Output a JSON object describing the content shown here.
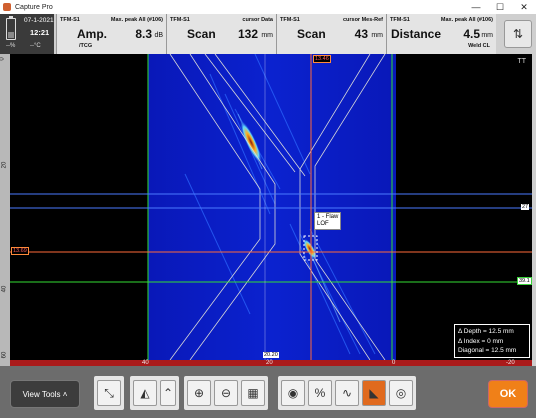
{
  "window": {
    "title": "Capture Pro",
    "minimize": "—",
    "maximize": "☐",
    "close": "✕"
  },
  "status": {
    "date": "07-1-2021",
    "time": "12:21",
    "battery": "--%",
    "temperature": "--°C"
  },
  "readouts": [
    {
      "source": "TFM-S1",
      "label": "Max. peak All (#106)",
      "main": "Amp.",
      "sub": "/TCG",
      "value": "8.3",
      "unit": "dB",
      "sub2": ""
    },
    {
      "source": "TFM-S1",
      "label": "cursor Data",
      "main": "Scan",
      "sub": "",
      "value": "132",
      "unit": "mm",
      "sub2": ""
    },
    {
      "source": "TFM-S1",
      "label": "cursor Mes-Ref",
      "main": "Scan",
      "sub": "",
      "value": "43",
      "unit": "mm",
      "sub2": ""
    },
    {
      "source": "TFM-S1",
      "label": "Max. peak All (#106)",
      "main": "Distance",
      "sub": "",
      "value": "4.5",
      "unit": "mm",
      "sub2": "Weld CL"
    }
  ],
  "settings_icon": "settings-swap-icon",
  "scan": {
    "mode_label": "TT",
    "left_ruler": [
      "0",
      "20",
      "40",
      "60"
    ],
    "bottom_ruler": [
      "40",
      "20",
      "0",
      "-20",
      "-40"
    ],
    "cursor_tags": {
      "top_red": "13.46",
      "left_red": "13.69",
      "right_blue": "27",
      "right_green": "39.1",
      "bottom_white": "20.20"
    },
    "flaw": {
      "line1": "1 - Flaw",
      "line2": "LOF"
    },
    "measurement": {
      "depth": "Δ Depth   = 12.5   mm",
      "index": "Δ Index    = 0 mm",
      "diagonal": "Diagonal = 12.5   mm"
    },
    "colors": {
      "background": "#000000",
      "scan_blue": "#0a1fc8",
      "cursor_red": "#ff6a3a",
      "cursor_green": "#33dd33",
      "cursor_blue": "#4a7aff",
      "ruler_red": "#aa1a1a"
    }
  },
  "toolbar": {
    "view_tools": "View Tools  ˄",
    "ok": "OK",
    "buttons": [
      {
        "name": "fit-icon",
        "glyph": "⤡"
      },
      {
        "name": "mirror-icon",
        "glyph": "◭"
      },
      {
        "name": "chevron-up-icon",
        "glyph": "⌃"
      },
      {
        "name": "zoom-in-icon",
        "glyph": "⊕"
      },
      {
        "name": "zoom-out-icon",
        "glyph": "⊖"
      },
      {
        "name": "grid-icon",
        "glyph": "▦"
      },
      {
        "name": "palette-icon",
        "glyph": "◉"
      },
      {
        "name": "percent-icon",
        "glyph": "%"
      },
      {
        "name": "waveform-icon",
        "glyph": "∿"
      },
      {
        "name": "sector-icon",
        "glyph": "◣"
      },
      {
        "name": "eye-icon",
        "glyph": "◎"
      }
    ]
  }
}
